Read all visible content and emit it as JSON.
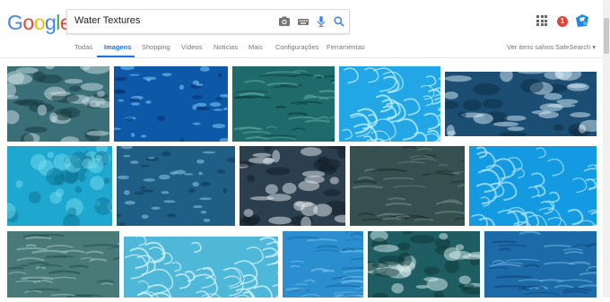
{
  "logo": {
    "letters": [
      {
        "ch": "G",
        "color": "#4285f4"
      },
      {
        "ch": "o",
        "color": "#ea4335"
      },
      {
        "ch": "o",
        "color": "#fbbc05"
      },
      {
        "ch": "g",
        "color": "#4285f4"
      },
      {
        "ch": "l",
        "color": "#34a853"
      },
      {
        "ch": "e",
        "color": "#ea4335"
      }
    ]
  },
  "search": {
    "query": "Water Textures"
  },
  "notifications": {
    "count": "1"
  },
  "tabs": [
    {
      "label": "Todas",
      "active": false
    },
    {
      "label": "Imagens",
      "active": true
    },
    {
      "label": "Shopping",
      "active": false
    },
    {
      "label": "Vídeos",
      "active": false
    },
    {
      "label": "Notícias",
      "active": false
    },
    {
      "label": "Mais",
      "active": false
    },
    {
      "label": "Configurações",
      "active": false
    },
    {
      "label": "Ferramentas",
      "active": false
    }
  ],
  "right_links": {
    "saved": "Ver itens salvos",
    "safesearch": "SafeSearch ▾"
  },
  "results": [
    {
      "style": "foam",
      "base": "#3a6f78",
      "light": "#cfe2e6",
      "dark": "#16363e"
    },
    {
      "style": "sparkle",
      "base": "#0e58a8",
      "light": "#7fd0ff",
      "dark": "#062e6a"
    },
    {
      "style": "ripple",
      "base": "#1f6a6a",
      "light": "#5fa8a4",
      "dark": "#0d3d3f"
    },
    {
      "style": "caustic",
      "base": "#22a6e6",
      "light": "#bff0ff",
      "dark": "#0c78c0"
    },
    {
      "style": "foam",
      "base": "#1b4e72",
      "light": "#d9eefa",
      "dark": "#0b2a44"
    },
    {
      "style": "bubbles",
      "base": "#1ea8cf",
      "light": "#7fe3f5",
      "dark": "#0b6c8c"
    },
    {
      "style": "sparkle",
      "base": "#1f5f86",
      "light": "#8ec7e6",
      "dark": "#0d3550"
    },
    {
      "style": "foam",
      "base": "#2b3f4e",
      "light": "#e7eef2",
      "dark": "#111c24"
    },
    {
      "style": "ripple",
      "base": "#35504e",
      "light": "#6d8886",
      "dark": "#1a2d2c"
    },
    {
      "style": "caustic",
      "base": "#149ae0",
      "light": "#aee6ff",
      "dark": "#0a6cb4"
    },
    {
      "style": "ripple",
      "base": "#4a7a78",
      "light": "#9cc0bd",
      "dark": "#27504e"
    },
    {
      "style": "caustic",
      "base": "#4fb8d8",
      "light": "#d4f4fb",
      "dark": "#2a8eb4"
    },
    {
      "style": "ripple",
      "base": "#2b8fcf",
      "light": "#7cc3ec",
      "dark": "#176aa6"
    },
    {
      "style": "foam",
      "base": "#1e5e62",
      "light": "#dcefee",
      "dark": "#0c3436"
    },
    {
      "style": "ripple",
      "base": "#1c6aa8",
      "light": "#6aaee0",
      "dark": "#0e4478"
    }
  ]
}
